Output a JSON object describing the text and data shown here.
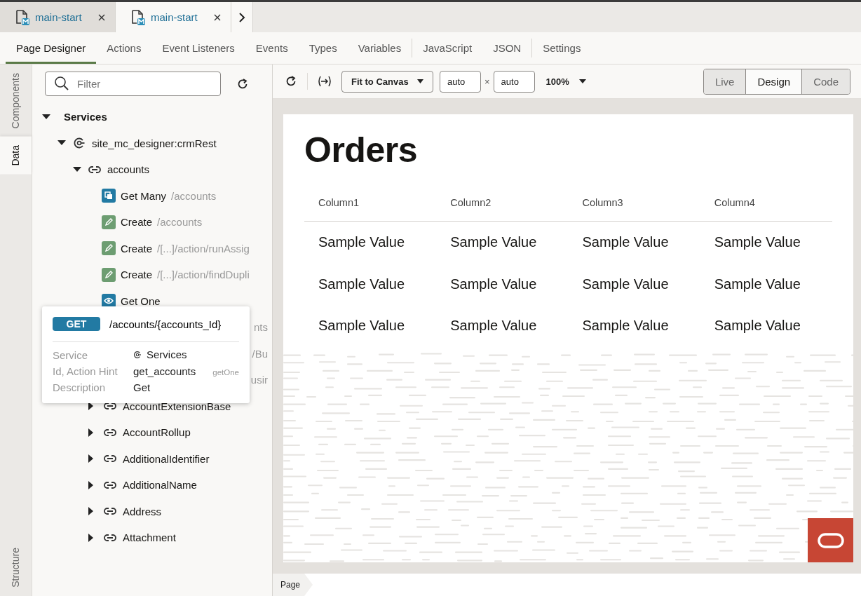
{
  "file_tabs": [
    {
      "label": "main-start",
      "selected": false
    },
    {
      "label": "main-start",
      "selected": true
    }
  ],
  "nav_tabs": [
    {
      "label": "Page Designer",
      "selected": true,
      "separator_before": false
    },
    {
      "label": "Actions",
      "selected": false,
      "separator_before": false
    },
    {
      "label": "Event Listeners",
      "selected": false,
      "separator_before": false
    },
    {
      "label": "Events",
      "selected": false,
      "separator_before": false
    },
    {
      "label": "Types",
      "selected": false,
      "separator_before": false
    },
    {
      "label": "Variables",
      "selected": false,
      "separator_before": false
    },
    {
      "label": "JavaScript",
      "selected": false,
      "separator_before": true
    },
    {
      "label": "JSON",
      "selected": false,
      "separator_before": false
    },
    {
      "label": "Settings",
      "selected": false,
      "separator_before": true
    }
  ],
  "side_tabs": [
    {
      "label": "Components",
      "selected": false
    },
    {
      "label": "Data",
      "selected": true
    },
    {
      "label": "Structure",
      "selected": false
    }
  ],
  "filter": {
    "placeholder": "Filter"
  },
  "tree": [
    {
      "label": "Services",
      "kind": "root",
      "expanded": true,
      "children": [
        {
          "label": "site_mc_designer:crmRest",
          "kind": "service",
          "expanded": true,
          "children": [
            {
              "label": "accounts",
              "kind": "resource",
              "expanded": true,
              "children": [
                {
                  "label": "Get Many",
                  "kind": "get-many",
                  "path": "/accounts"
                },
                {
                  "label": "Create",
                  "kind": "create",
                  "path": "/accounts"
                },
                {
                  "label": "Create",
                  "kind": "create",
                  "path": "/[...]/action/runAssig"
                },
                {
                  "label": "Create",
                  "kind": "create",
                  "path": "/[...]/action/findDupli"
                },
                {
                  "label": "Get One",
                  "kind": "get-one"
                },
                {
                  "label": "nts",
                  "kind": "covered"
                },
                {
                  "label": "/Bu",
                  "kind": "covered"
                },
                {
                  "label": "usir",
                  "kind": "covered"
                },
                {
                  "label": "AccountExtensionBase",
                  "kind": "resource",
                  "expanded": false
                },
                {
                  "label": "AccountRollup",
                  "kind": "resource",
                  "expanded": false
                },
                {
                  "label": "AdditionalIdentifier",
                  "kind": "resource",
                  "expanded": false
                },
                {
                  "label": "AdditionalName",
                  "kind": "resource",
                  "expanded": false
                },
                {
                  "label": "Address",
                  "kind": "resource",
                  "expanded": false
                },
                {
                  "label": "Attachment",
                  "kind": "resource",
                  "expanded": false
                }
              ]
            }
          ]
        }
      ]
    }
  ],
  "popup": {
    "method": "GET",
    "path": "/accounts/{accounts_Id}",
    "fields": [
      {
        "label": "Service",
        "value": "Services",
        "kind": "service"
      },
      {
        "label": "Id, Action Hint",
        "value": "get_accounts",
        "hint": "getOne",
        "kind": "text"
      },
      {
        "label": "Description",
        "value": "Get",
        "kind": "text"
      }
    ]
  },
  "toolbar": {
    "fit": "Fit to Canvas",
    "width": "auto",
    "size_separator": "×",
    "height": "auto",
    "zoom": "100%",
    "modes": [
      {
        "label": "Live",
        "selected": false
      },
      {
        "label": "Design",
        "selected": true
      },
      {
        "label": "Code",
        "selected": false
      }
    ]
  },
  "page": {
    "title": "Orders",
    "columns": [
      "Column1",
      "Column2",
      "Column3",
      "Column4"
    ],
    "rows": [
      [
        "Sample Value",
        "Sample Value",
        "Sample Value",
        "Sample Value"
      ],
      [
        "Sample Value",
        "Sample Value",
        "Sample Value",
        "Sample Value"
      ],
      [
        "Sample Value",
        "Sample Value",
        "Sample Value",
        "Sample Value"
      ]
    ]
  },
  "breadcrumb": [
    "Page"
  ]
}
